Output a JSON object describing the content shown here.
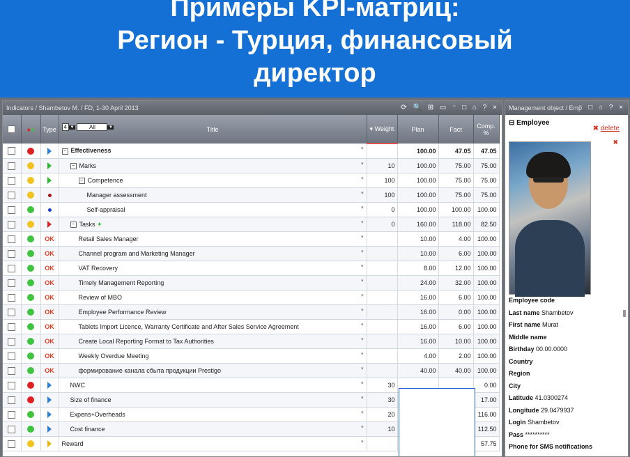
{
  "slide": {
    "title_line1": "Примеры KPI-матриц:",
    "title_line2": "Регион - Турция, финансовый",
    "title_line3": "директор"
  },
  "left_panel": {
    "title": "Indicators / Shambetov M. / FD, 1-30 April 2013",
    "tools": "⟳ 🔍 ⊞ ▭ ⁻ □ ⌂ ? ×",
    "columns": {
      "type": "Type",
      "level": "4",
      "filter": "All",
      "title": "Title",
      "weight": "Weight",
      "plan": "Plan",
      "fact": "Fact",
      "comp": "Comp. %"
    },
    "rows": [
      {
        "status": "#e02020",
        "type": "tri-blue",
        "indent": 0,
        "exp": "⊟",
        "title": "Effectiveness",
        "bold": true,
        "weight": "",
        "plan": "100.00",
        "fact": "47.05",
        "comp": "47.05"
      },
      {
        "status": "#f2c21e",
        "type": "tri-green",
        "indent": 1,
        "exp": "⊟",
        "title": "Marks",
        "weight": "10",
        "plan": "100.00",
        "fact": "75.00",
        "comp": "75.00"
      },
      {
        "status": "#f2c21e",
        "type": "tri-green",
        "indent": 2,
        "exp": "⊟",
        "title": "Competence",
        "weight": "100",
        "plan": "100.00",
        "fact": "75.00",
        "comp": "75.00"
      },
      {
        "status": "#f2c21e",
        "type": "dot-red",
        "indent": 3,
        "title": "Manager assessment",
        "weight": "100",
        "plan": "100.00",
        "fact": "75.00",
        "comp": "75.00"
      },
      {
        "status": "#3ec43e",
        "type": "dot-blue",
        "indent": 3,
        "title": "Self-appraisal",
        "weight": "0",
        "plan": "100.00",
        "fact": "100.00",
        "comp": "100.00"
      },
      {
        "status": "#f2c21e",
        "type": "tri-red",
        "indent": 1,
        "exp": "⊟",
        "title": "Tasks",
        "plus": "✦",
        "weight": "0",
        "plan": "160.00",
        "fact": "118.00",
        "comp": "82.50"
      },
      {
        "status": "#3ec43e",
        "type": "OK",
        "indent": 2,
        "title": "Retail Sales Manager",
        "weight": "",
        "plan": "10.00",
        "fact": "4.00",
        "comp": "100.00"
      },
      {
        "status": "#3ec43e",
        "type": "OK",
        "indent": 2,
        "title": "Channel program and Marketing Manager",
        "weight": "",
        "plan": "10.00",
        "fact": "6.00",
        "comp": "100.00"
      },
      {
        "status": "#3ec43e",
        "type": "OK",
        "indent": 2,
        "title": "VAT Recovery",
        "weight": "",
        "plan": "8.00",
        "fact": "12.00",
        "comp": "100.00"
      },
      {
        "status": "#3ec43e",
        "type": "OK",
        "indent": 2,
        "title": "Timely Management Reporting",
        "weight": "",
        "plan": "24.00",
        "fact": "32.00",
        "comp": "100.00"
      },
      {
        "status": "#3ec43e",
        "type": "OK",
        "indent": 2,
        "title": "Review of MBO",
        "weight": "",
        "plan": "16.00",
        "fact": "6.00",
        "comp": "100.00"
      },
      {
        "status": "#3ec43e",
        "type": "OK",
        "indent": 2,
        "title": "Employee Performance Review",
        "weight": "",
        "plan": "16.00",
        "fact": "0.00",
        "comp": "100.00"
      },
      {
        "status": "#3ec43e",
        "type": "OK",
        "indent": 2,
        "title": "Tablets Import Licence, Warranty Certificate and After Sales Service Agreement",
        "weight": "",
        "plan": "16.00",
        "fact": "6.00",
        "comp": "100.00"
      },
      {
        "status": "#3ec43e",
        "type": "OK",
        "indent": 2,
        "title": "Create Local Reporting Format to Tax Authorities",
        "weight": "",
        "plan": "16.00",
        "fact": "10.00",
        "comp": "100.00"
      },
      {
        "status": "#3ec43e",
        "type": "OK",
        "indent": 2,
        "title": "Weekly Overdue Meeting",
        "weight": "",
        "plan": "4.00",
        "fact": "2.00",
        "comp": "100.00"
      },
      {
        "status": "#3ec43e",
        "type": "OK",
        "indent": 2,
        "title": "формирование канала сбыта продукции Prestigo",
        "weight": "",
        "plan": "40.00",
        "fact": "40.00",
        "comp": "100.00"
      },
      {
        "status": "#e02020",
        "type": "tri-blue",
        "indent": 1,
        "title": "NWC",
        "weight": "30",
        "plan": "",
        "fact": "",
        "comp": "0.00"
      },
      {
        "status": "#e02020",
        "type": "tri-blue",
        "indent": 1,
        "title": "Size of finance",
        "weight": "30",
        "plan": "",
        "fact": "",
        "comp": "17.00"
      },
      {
        "status": "#3ec43e",
        "type": "tri-blue",
        "indent": 1,
        "title": "Expens+Overheads",
        "weight": "20",
        "plan": "",
        "fact": "",
        "comp": "116.00"
      },
      {
        "status": "#3ec43e",
        "type": "tri-blue",
        "indent": 1,
        "title": "Cost finance",
        "weight": "10",
        "plan": "",
        "fact": "",
        "comp": "112.50"
      },
      {
        "status": "#f2c21e",
        "type": "tri-yellow",
        "indent": 0,
        "title": "Reward",
        "weight": "",
        "plan": "",
        "fact": "",
        "comp": "57.75"
      }
    ]
  },
  "right_panel": {
    "title": "Management object / Emp",
    "tools": "⁻ □ ⌂ ? ×",
    "section": "Employee",
    "delete_label": "delete",
    "fields": [
      {
        "label": "Employee code",
        "value": ""
      },
      {
        "label": "Last name",
        "value": "Shambetov"
      },
      {
        "label": "First name",
        "value": "Murat"
      },
      {
        "label": "Middle name",
        "value": ""
      },
      {
        "label": "Birthday",
        "value": "00.00.0000"
      },
      {
        "label": "Country",
        "value": ""
      },
      {
        "label": "Region",
        "value": ""
      },
      {
        "label": "City",
        "value": ""
      },
      {
        "label": "Latitude",
        "value": "41.0300274"
      },
      {
        "label": "Longitude",
        "value": "29.0479937"
      },
      {
        "label": "Login",
        "value": "Shambetov"
      },
      {
        "label": "Pass",
        "value": "**********"
      },
      {
        "label": "Phone for SMS notifications",
        "value": ""
      }
    ]
  }
}
